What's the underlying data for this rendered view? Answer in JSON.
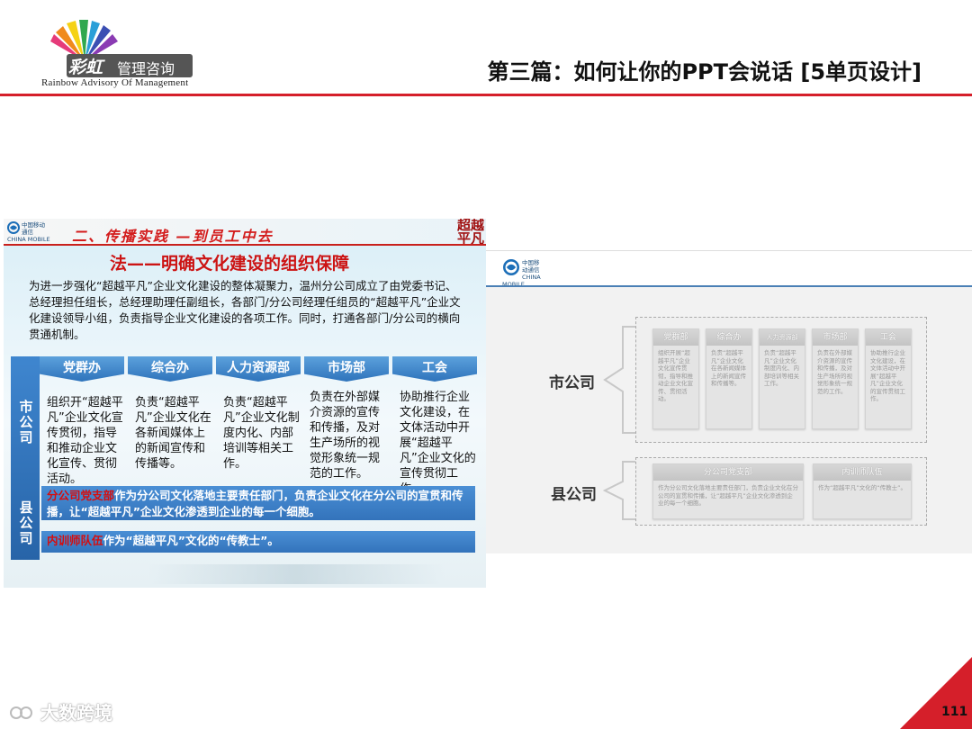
{
  "header": {
    "logo_brand": "彩虹",
    "logo_name": "管理咨询",
    "logo_tagline": "Rainbow  Advisory  Of  Management",
    "title": "第三篇：如何让你的PPT会说话 [5单页设计]"
  },
  "left_slide": {
    "carrier_cn": "中国移动通信",
    "carrier_en": "CHINA MOBILE",
    "headline": "二、传播实践 —到员工中去",
    "badge_1": "超越",
    "badge_2": "平凡",
    "subtitle": "法——明确文化建设的组织保障",
    "paragraph": "为进一步强化“超越平凡”企业文化建设的整体凝聚力，温州分公司成立了由党委书记、总经理担任组长，总经理助理任副组长，各部门/分公司经理任组员的“超越平凡”企业文化建设领导小组，负责指导企业文化建设的各项工作。同时，打通各部门/分公司的横向贯通机制。",
    "side_city": "市公司",
    "side_county": "县公司",
    "departments": [
      {
        "name": "党群办",
        "text": "组织开“超越平凡”企业文化宣传贯彻，指导和推动企业文化宣传、贯彻活动。"
      },
      {
        "name": "综合办",
        "text": "负责“超越平凡”企业文化在各新闻媒体上的新闻宣传和传播等。"
      },
      {
        "name": "人力资源部",
        "text": "负责“超越平凡”企业文化制度内化、内部培训等相关工作。"
      },
      {
        "name": "市场部",
        "text": "负责在外部媒介资源的宣传和传播，及对生产场所的视觉形象统一规范的工作。"
      },
      {
        "name": "工会",
        "text": "协助推行企业文化建设，在文体活动中开展“超越平凡”企业文化的宣传贯彻工作。"
      }
    ],
    "row1_highlight": "分公司党支部",
    "row1_text": "作为分公司文化落地主要责任部门，负责企业文化在分公司的宣贯和传播，让“超越平凡”企业文化渗透到企业的每一个细胞。",
    "row2_highlight": "内训师队伍",
    "row2_text": "作为“超越平凡”文化的“传教士”。"
  },
  "right_slide": {
    "carrier_cn": "中国移动通信",
    "carrier_en": "CHINA MOBILE",
    "city_label": "市公司",
    "county_label": "县公司",
    "city_cards": [
      {
        "name": "党群部",
        "text": "组织开展“超越平凡”企业文化宣传贯彻，指导和推动企业文化宣传、贯彻活动。"
      },
      {
        "name": "综合办",
        "text": "负责“超越平凡”企业文化在各新闻媒体上的新闻宣传和传播等。"
      },
      {
        "name": "人力资源部",
        "text": "负责“超越平凡”企业文化制度内化、内部培训等相关工作。"
      },
      {
        "name": "市场部",
        "text": "负责在外部媒介资源的宣传和传播，及对生产场所的视觉形象统一规范的工作。"
      },
      {
        "name": "工会",
        "text": "协助推行企业文化建设，在文体活动中开展“超越平凡”企业文化的宣传贯彻工作。"
      }
    ],
    "county_cards": [
      {
        "name": "分公司党支部",
        "text": "作为分公司文化落地主要责任部门，负责企业文化在分公司的宣贯和传播，让“超越平凡”企业文化渗透到企业的每一个细胞。"
      },
      {
        "name": "内训师队伍",
        "text": "作为“超越平凡”文化的“传教士”。"
      }
    ]
  },
  "footer": {
    "watermark": "大数跨境",
    "page_number": "111"
  },
  "colors": {
    "accent_red": "#d51f2a",
    "tab_blue": "#2e73bb",
    "highlight_red": "#d60d0d"
  }
}
